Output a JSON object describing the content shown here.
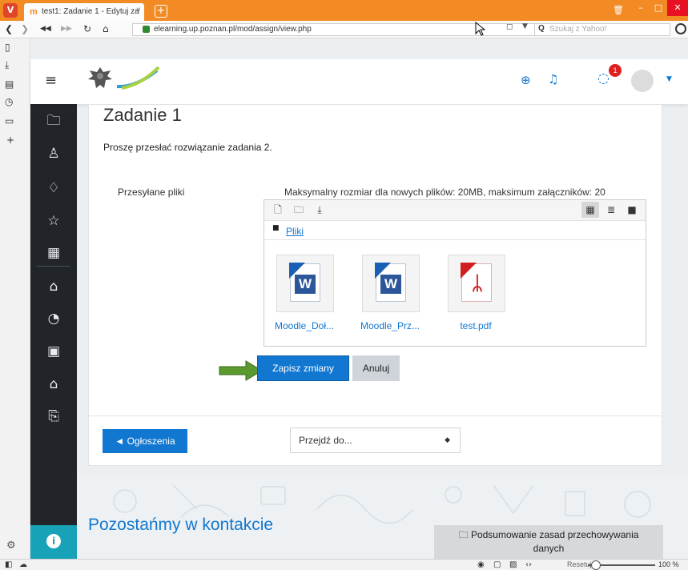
{
  "browser": {
    "tab_title": "test1: Zadanie 1 - Edytuj za",
    "url": "elearning.up.poznan.pl/mod/assign/view.php",
    "search_placeholder": "Szukaj z Yahoo!",
    "status_reset": "Resetuj",
    "zoom": "100 %"
  },
  "navbar": {
    "message_count": "1"
  },
  "page": {
    "title": "Zadanie 1",
    "intro": "Proszę przesłać rozwiązanie zadania 2.",
    "field_label": "Przesyłane pliki",
    "limits": "Maksymalny rozmiar dla nowych plików: 20MB, maksimum załączników: 20",
    "folder_link": "Pliki",
    "files": [
      {
        "name": "Moodle_Doł...",
        "type": "word"
      },
      {
        "name": "Moodle_Prz...",
        "type": "word"
      },
      {
        "name": "test.pdf",
        "type": "pdf"
      }
    ],
    "save_button": "Zapisz zmiany",
    "cancel_button": "Anuluj",
    "prev_button": "◄ Ogłoszenia",
    "jump_select": "Przejdź do..."
  },
  "footer": {
    "heading": "Pozostańmy w kontakcie",
    "policy_line1": "Podsumowanie zasad przechowywania",
    "policy_line2": "danych"
  },
  "colors": {
    "primary": "#1177d1",
    "drawer": "#212529",
    "accessibility": "#17a2b8",
    "arrow": "#5a9a2e",
    "browser_chrome": "#f28b24"
  }
}
